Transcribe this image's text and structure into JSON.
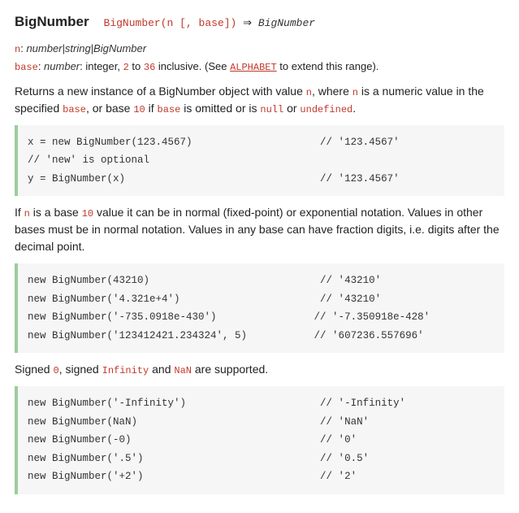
{
  "header": {
    "title": "BigNumber",
    "signature_fn": "BigNumber(n [, base])",
    "signature_arrow": " ⇒ ",
    "signature_ret": "BigNumber"
  },
  "params": {
    "n_name": "n",
    "n_sep": ": ",
    "n_type": "number|string|BigNumber",
    "base_name": "base",
    "base_sep": ": ",
    "base_type": "number",
    "base_pre": ": integer, ",
    "base_lo": "2",
    "base_mid": " to ",
    "base_hi": "36",
    "base_post1": " inclusive. (See ",
    "base_link": "ALPHABET",
    "base_post2": " to extend this range)."
  },
  "para1": {
    "t1": "Returns a new instance of a BigNumber object with value ",
    "c1": "n",
    "t2": ", where ",
    "c2": "n",
    "t3": " is a numeric value in the specified ",
    "c3": "base",
    "t4": ", or base ",
    "c4": "10",
    "t5": " if ",
    "c5": "base",
    "t6": " is omitted or is ",
    "c6": "null",
    "t7": " or ",
    "c7": "undefined",
    "t8": "."
  },
  "code1": "x = new BigNumber(123.4567)                     // '123.4567'\n// 'new' is optional\ny = BigNumber(x)                                // '123.4567'",
  "para2": {
    "t1": "If ",
    "c1": "n",
    "t2": " is a base ",
    "c2": "10",
    "t3": " value it can be in normal (fixed-point) or exponential notation. Values in other bases must be in normal notation. Values in any base can have fraction digits, i.e. digits after the decimal point."
  },
  "code2": "new BigNumber(43210)                            // '43210'\nnew BigNumber('4.321e+4')                       // '43210'\nnew BigNumber('-735.0918e-430')                // '-7.350918e-428'\nnew BigNumber('123412421.234324', 5)           // '607236.557696'",
  "para3": {
    "t1": "Signed ",
    "c1": "0",
    "t2": ", signed ",
    "c2": "Infinity",
    "t3": " and ",
    "c3": "NaN",
    "t4": " are supported."
  },
  "code3": "new BigNumber('-Infinity')                      // '-Infinity'\nnew BigNumber(NaN)                              // 'NaN'\nnew BigNumber(-0)                               // '0'\nnew BigNumber('.5')                             // '0.5'\nnew BigNumber('+2')                             // '2'"
}
